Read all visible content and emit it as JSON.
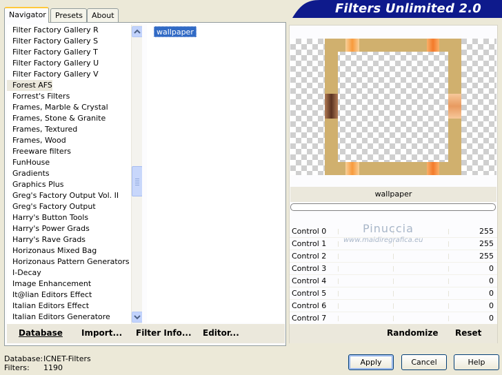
{
  "window": {
    "title": "Filters Unlimited 2.0"
  },
  "tabs": [
    {
      "label": "Navigator",
      "active": true
    },
    {
      "label": "Presets",
      "active": false
    },
    {
      "label": "About",
      "active": false
    }
  ],
  "categories": {
    "selected": "Forest AFS",
    "items": [
      "Filter Factory Gallery R",
      "Filter Factory Gallery S",
      "Filter Factory Gallery T",
      "Filter Factory Gallery U",
      "Filter Factory Gallery V",
      "Forest AFS",
      "Forrest's Filters",
      "Frames, Marble & Crystal",
      "Frames, Stone & Granite",
      "Frames, Textured",
      "Frames, Wood",
      "Freeware filters",
      "FunHouse",
      "Gradients",
      "Graphics Plus",
      "Greg's Factory Output Vol. II",
      "Greg's Factory Output",
      "Harry's Button Tools",
      "Harry's Power Grads",
      "Harry's Rave Grads",
      "Horizonaus Mixed Bag",
      "Horizonaus Pattern Generators",
      "I-Decay",
      "Image Enhancement",
      "It@lian Editors Effect",
      "Italian Editors Effect",
      "Italian Editors Generatore"
    ]
  },
  "filters": {
    "selected": "wallpaper",
    "items": [
      "wallpaper"
    ]
  },
  "left_buttons": {
    "database": "Database",
    "import": "Import...",
    "filter_info": "Filter Info...",
    "editor": "Editor..."
  },
  "preview": {
    "filter_name": "wallpaper",
    "frame_color": "#d0b06e",
    "progress": 0
  },
  "controls": [
    {
      "label": "Control 0",
      "value": "255"
    },
    {
      "label": "Control 1",
      "value": "255"
    },
    {
      "label": "Control 2",
      "value": "255"
    },
    {
      "label": "Control 3",
      "value": "0"
    },
    {
      "label": "Control 4",
      "value": "0"
    },
    {
      "label": "Control 5",
      "value": "0"
    },
    {
      "label": "Control 6",
      "value": "0"
    },
    {
      "label": "Control 7",
      "value": "0"
    }
  ],
  "watermark": {
    "name": "Pinuccia",
    "site": "www.maidiregrafica.eu"
  },
  "right_buttons": {
    "randomize": "Randomize",
    "reset": "Reset"
  },
  "status": {
    "database_label": "Database:",
    "database_value": "ICNET-Filters",
    "filters_label": "Filters:",
    "filters_value": "1190"
  },
  "dialog_buttons": {
    "apply": "Apply",
    "cancel": "Cancel",
    "help": "Help"
  },
  "colors": {
    "title_banner": "#0e1a8c",
    "selection": "#316ac5",
    "accent_orange": "#f7a04a",
    "accent_brown": "#7a4a2c"
  }
}
